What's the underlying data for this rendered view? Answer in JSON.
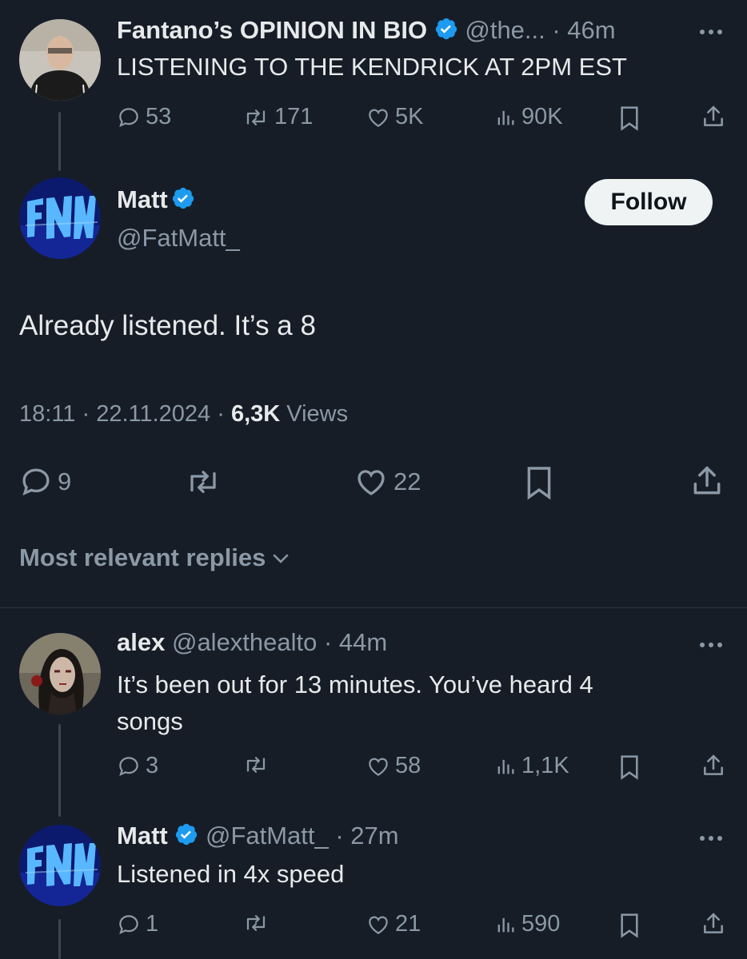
{
  "colors": {
    "background": "#161d27",
    "verified": "#1d9bf0",
    "muted": "#8b98a5",
    "text": "#e7e9ea"
  },
  "parent_tweet": {
    "display_name": "Fantano’s OPINION IN BIO",
    "handle_time": "@the... · 46m",
    "text": "LISTENING TO THE KENDRICK AT 2PM EST",
    "replies": "53",
    "reposts": "171",
    "likes": "5K",
    "views": "90K"
  },
  "main_tweet": {
    "display_name": "Matt",
    "handle": "@FatMatt_",
    "follow_label": "Follow",
    "text": "Already listened. It’s a 8",
    "timestamp": "18:11 · 22.11.2024 · ",
    "views_count": "6,3K",
    "views_label": " Views",
    "replies": "9",
    "likes": "22"
  },
  "replies_header": {
    "label": "Most relevant replies"
  },
  "reply_1": {
    "display_name": "alex",
    "handle_time": "@alexthealto · 44m",
    "text_line1": "It’s been out for 13 minutes. You’ve heard 4",
    "text_line2": "songs",
    "replies": "3",
    "likes": "58",
    "views": "1,1K"
  },
  "reply_2": {
    "display_name": "Matt",
    "handle_time": "@FatMatt_ · 27m",
    "text": "Listened in 4x speed",
    "replies": "1",
    "likes": "21",
    "views": "590"
  },
  "icons": [
    "reply-icon",
    "repost-icon",
    "like-icon",
    "views-icon",
    "bookmark-icon",
    "share-icon",
    "verified-badge-icon",
    "more-options-icon",
    "chevron-down-icon"
  ]
}
